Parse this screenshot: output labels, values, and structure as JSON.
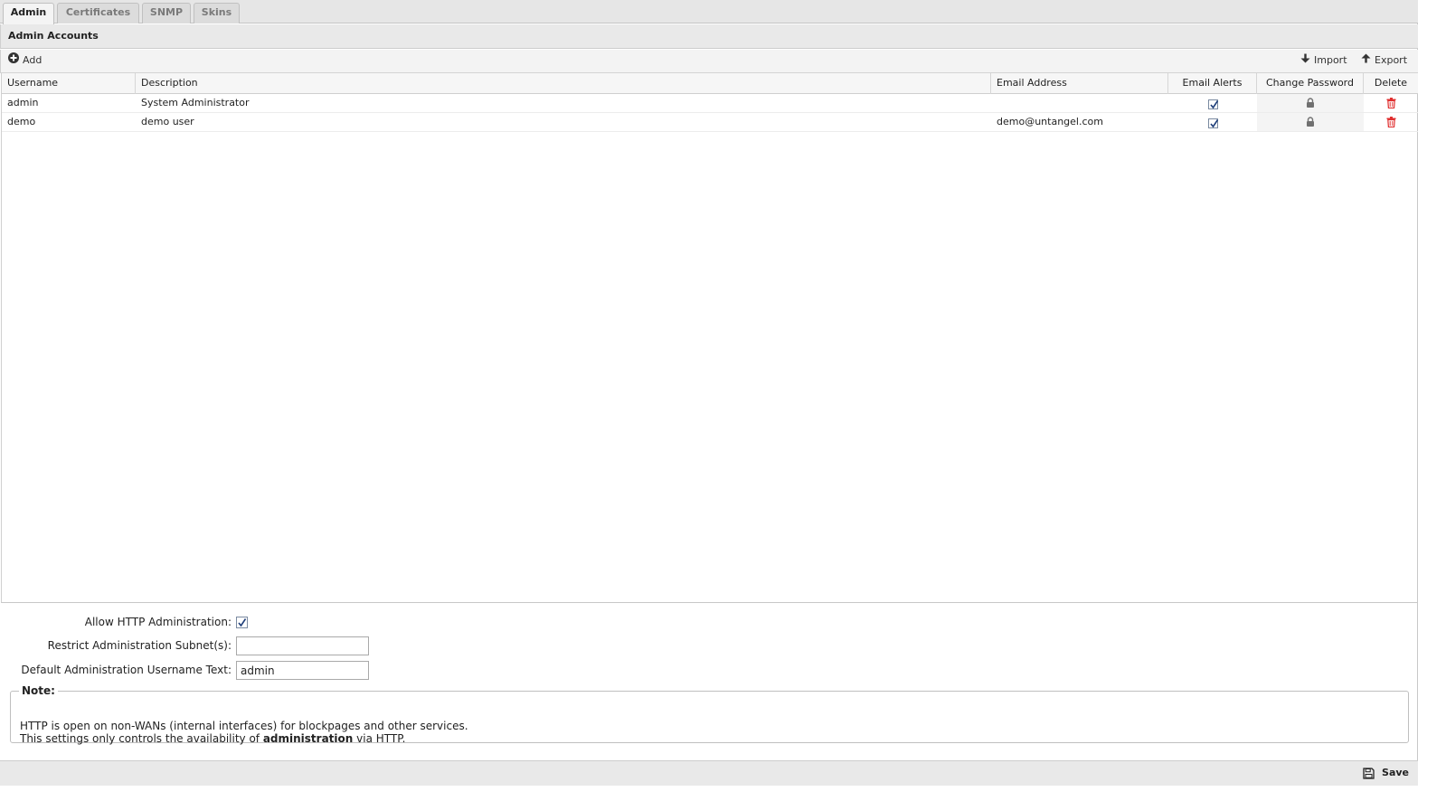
{
  "tabs": [
    {
      "label": "Admin",
      "active": true
    },
    {
      "label": "Certificates",
      "active": false
    },
    {
      "label": "SNMP",
      "active": false
    },
    {
      "label": "Skins",
      "active": false
    }
  ],
  "panel": {
    "title": "Admin Accounts"
  },
  "toolbar": {
    "add_label": "Add",
    "import_label": "Import",
    "export_label": "Export"
  },
  "grid": {
    "columns": [
      "Username",
      "Description",
      "Email Address",
      "Email Alerts",
      "Change Password",
      "Delete"
    ],
    "rows": [
      {
        "username": "admin",
        "description": "System Administrator",
        "email": "",
        "email_alerts": true
      },
      {
        "username": "demo",
        "description": "demo user",
        "email": "demo@untangel.com",
        "email_alerts": true
      }
    ]
  },
  "form": {
    "allow_http_label": "Allow HTTP Administration:",
    "allow_http_checked": true,
    "restrict_subnets_label": "Restrict Administration Subnet(s):",
    "restrict_subnets_value": "",
    "default_username_label": "Default Administration Username Text:",
    "default_username_value": "admin"
  },
  "note": {
    "legend": "Note:",
    "line1": "HTTP is open on non-WANs (internal interfaces) for blockpages and other services.",
    "line2_prefix": "This settings only controls the availability of ",
    "line2_bold": "administration",
    "line2_suffix": " via HTTP."
  },
  "footer": {
    "save_label": "Save"
  },
  "colors": {
    "delete_icon": "#e03030",
    "lock_icon": "#707070",
    "check": "#1f3f7a"
  }
}
